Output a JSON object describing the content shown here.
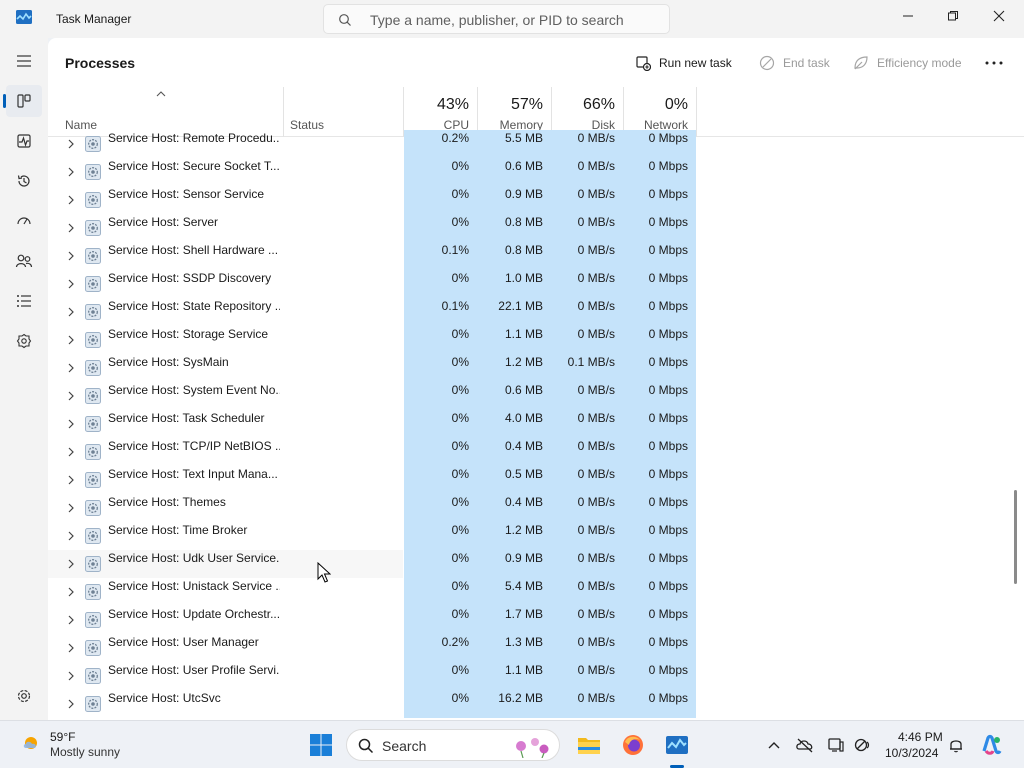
{
  "app": {
    "title": "Task Manager",
    "search_placeholder": "Type a name, publisher, or PID to search"
  },
  "window_controls": {
    "minimize_icon": "minimize-icon",
    "maximize_icon": "maximize-icon",
    "close_icon": "close-icon"
  },
  "sidebar": {
    "items": [
      {
        "name": "hamburger-icon"
      },
      {
        "name": "processes-icon",
        "active": true
      },
      {
        "name": "performance-icon"
      },
      {
        "name": "app-history-icon"
      },
      {
        "name": "startup-apps-icon"
      },
      {
        "name": "users-icon"
      },
      {
        "name": "details-icon"
      },
      {
        "name": "services-icon"
      },
      {
        "name": "settings-icon"
      }
    ]
  },
  "toolbar": {
    "page_title": "Processes",
    "run_new_task": "Run new task",
    "end_task": "End task",
    "efficiency_mode": "Efficiency mode",
    "more_icon": "more-options-icon"
  },
  "columns": {
    "name": "Name",
    "status": "Status",
    "cpu": {
      "percent": "43%",
      "label": "CPU"
    },
    "memory": {
      "percent": "57%",
      "label": "Memory"
    },
    "disk": {
      "percent": "66%",
      "label": "Disk"
    },
    "network": {
      "percent": "0%",
      "label": "Network"
    }
  },
  "rows": [
    {
      "name": "Service Host: Remote Procedu...",
      "cpu": "0.2%",
      "memory": "5.5 MB",
      "disk": "0 MB/s",
      "network": "0 Mbps"
    },
    {
      "name": "Service Host: Secure Socket T...",
      "cpu": "0%",
      "memory": "0.6 MB",
      "disk": "0 MB/s",
      "network": "0 Mbps"
    },
    {
      "name": "Service Host: Sensor Service",
      "cpu": "0%",
      "memory": "0.9 MB",
      "disk": "0 MB/s",
      "network": "0 Mbps"
    },
    {
      "name": "Service Host: Server",
      "cpu": "0%",
      "memory": "0.8 MB",
      "disk": "0 MB/s",
      "network": "0 Mbps"
    },
    {
      "name": "Service Host: Shell Hardware ...",
      "cpu": "0.1%",
      "memory": "0.8 MB",
      "disk": "0 MB/s",
      "network": "0 Mbps"
    },
    {
      "name": "Service Host: SSDP Discovery",
      "cpu": "0%",
      "memory": "1.0 MB",
      "disk": "0 MB/s",
      "network": "0 Mbps"
    },
    {
      "name": "Service Host: State Repository ...",
      "cpu": "0.1%",
      "memory": "22.1 MB",
      "disk": "0 MB/s",
      "network": "0 Mbps"
    },
    {
      "name": "Service Host: Storage Service",
      "cpu": "0%",
      "memory": "1.1 MB",
      "disk": "0 MB/s",
      "network": "0 Mbps"
    },
    {
      "name": "Service Host: SysMain",
      "cpu": "0%",
      "memory": "1.2 MB",
      "disk": "0.1 MB/s",
      "network": "0 Mbps"
    },
    {
      "name": "Service Host: System Event No...",
      "cpu": "0%",
      "memory": "0.6 MB",
      "disk": "0 MB/s",
      "network": "0 Mbps"
    },
    {
      "name": "Service Host: Task Scheduler",
      "cpu": "0%",
      "memory": "4.0 MB",
      "disk": "0 MB/s",
      "network": "0 Mbps"
    },
    {
      "name": "Service Host: TCP/IP NetBIOS ...",
      "cpu": "0%",
      "memory": "0.4 MB",
      "disk": "0 MB/s",
      "network": "0 Mbps"
    },
    {
      "name": "Service Host: Text Input Mana...",
      "cpu": "0%",
      "memory": "0.5 MB",
      "disk": "0 MB/s",
      "network": "0 Mbps"
    },
    {
      "name": "Service Host: Themes",
      "cpu": "0%",
      "memory": "0.4 MB",
      "disk": "0 MB/s",
      "network": "0 Mbps"
    },
    {
      "name": "Service Host: Time Broker",
      "cpu": "0%",
      "memory": "1.2 MB",
      "disk": "0 MB/s",
      "network": "0 Mbps"
    },
    {
      "name": "Service Host: Udk User Service...",
      "cpu": "0%",
      "memory": "0.9 MB",
      "disk": "0 MB/s",
      "network": "0 Mbps",
      "hover": true
    },
    {
      "name": "Service Host: Unistack Service ...",
      "cpu": "0%",
      "memory": "5.4 MB",
      "disk": "0 MB/s",
      "network": "0 Mbps"
    },
    {
      "name": "Service Host: Update Orchestr...",
      "cpu": "0%",
      "memory": "1.7 MB",
      "disk": "0 MB/s",
      "network": "0 Mbps"
    },
    {
      "name": "Service Host: User Manager",
      "cpu": "0.2%",
      "memory": "1.3 MB",
      "disk": "0 MB/s",
      "network": "0 Mbps"
    },
    {
      "name": "Service Host: User Profile Servi...",
      "cpu": "0%",
      "memory": "1.1 MB",
      "disk": "0 MB/s",
      "network": "0 Mbps"
    },
    {
      "name": "Service Host: UtcSvc",
      "cpu": "0%",
      "memory": "16.2 MB",
      "disk": "0 MB/s",
      "network": "0 Mbps"
    }
  ],
  "taskbar": {
    "weather": {
      "temp": "59°F",
      "desc": "Mostly sunny"
    },
    "search_label": "Search",
    "time": "4:46 PM",
    "date": "10/3/2024"
  },
  "colors": {
    "metric_highlight": "#c5e3fa",
    "accent": "#005fb8"
  }
}
